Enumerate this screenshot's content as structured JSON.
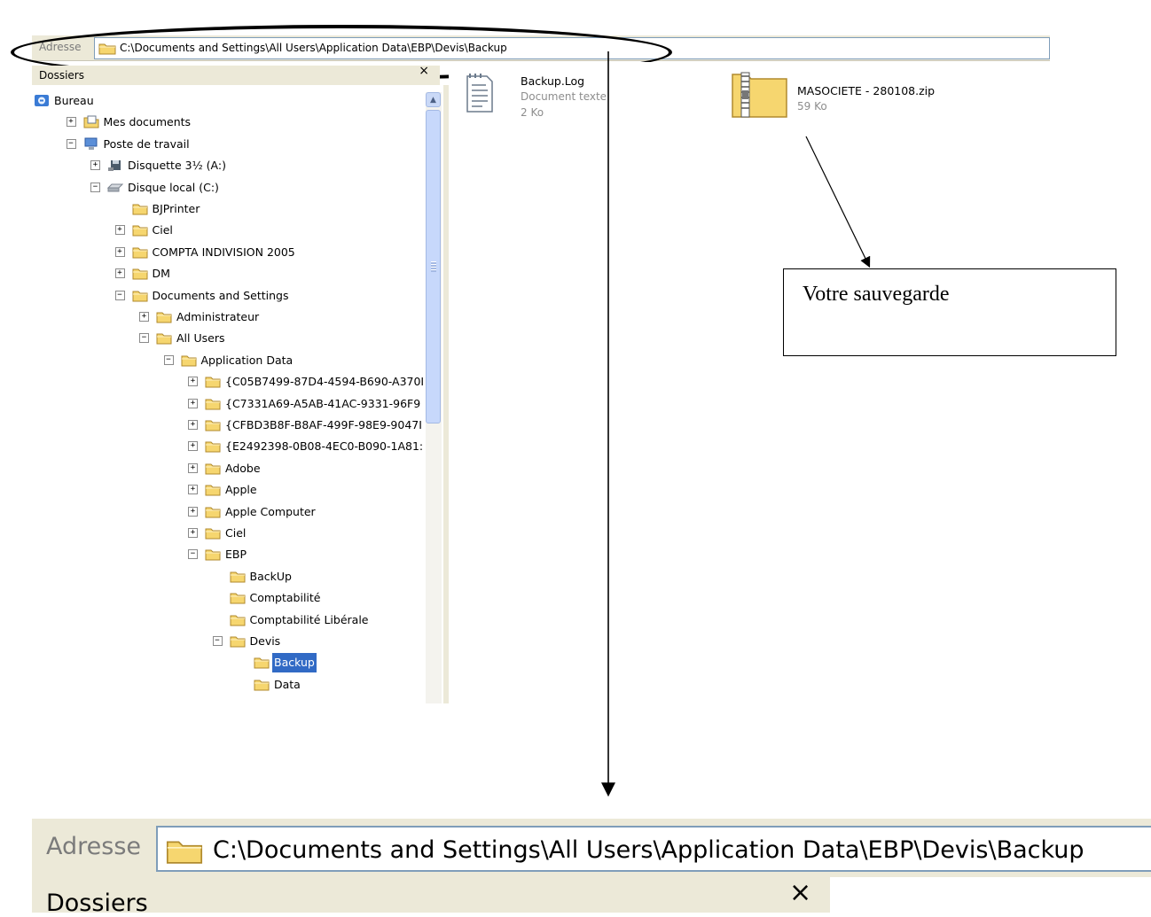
{
  "address_bar": {
    "label": "Adresse",
    "path": "C:\\Documents and Settings\\All Users\\Application Data\\EBP\\Devis\\Backup"
  },
  "folders_panel": {
    "title": "Dossiers",
    "close": "×",
    "tree": [
      {
        "label": "Bureau",
        "icon": "desktop-icon"
      },
      {
        "label": "Mes documents",
        "icon": "documents-icon",
        "expander": "+"
      },
      {
        "label": "Poste de travail",
        "icon": "computer-icon",
        "expander": "−"
      },
      {
        "label": "Disquette 3½ (A:)",
        "icon": "floppy-icon",
        "expander": "+"
      },
      {
        "label": "Disque local (C:)",
        "icon": "drive-icon",
        "expander": "−"
      },
      {
        "label": "BJPrinter",
        "icon": "folder-icon"
      },
      {
        "label": "Ciel",
        "icon": "folder-icon",
        "expander": "+"
      },
      {
        "label": "COMPTA INDIVISION 2005",
        "icon": "folder-icon",
        "expander": "+"
      },
      {
        "label": "DM",
        "icon": "folder-icon",
        "expander": "+"
      },
      {
        "label": "Documents and Settings",
        "icon": "folder-icon",
        "expander": "−"
      },
      {
        "label": "Administrateur",
        "icon": "folder-icon",
        "expander": "+"
      },
      {
        "label": "All Users",
        "icon": "folder-icon",
        "expander": "−"
      },
      {
        "label": "Application Data",
        "icon": "folder-icon",
        "expander": "−"
      },
      {
        "label": "{C05B7499-87D4-4594-B690-A370I",
        "icon": "folder-icon",
        "expander": "+"
      },
      {
        "label": "{C7331A69-A5AB-41AC-9331-96F9",
        "icon": "folder-icon",
        "expander": "+"
      },
      {
        "label": "{CFBD3B8F-B8AF-499F-98E9-9047I",
        "icon": "folder-icon",
        "expander": "+"
      },
      {
        "label": "{E2492398-0B08-4EC0-B090-1A81:",
        "icon": "folder-icon",
        "expander": "+"
      },
      {
        "label": "Adobe",
        "icon": "folder-icon",
        "expander": "+"
      },
      {
        "label": "Apple",
        "icon": "folder-icon",
        "expander": "+"
      },
      {
        "label": "Apple Computer",
        "icon": "folder-icon",
        "expander": "+"
      },
      {
        "label": "Ciel",
        "icon": "folder-icon",
        "expander": "+"
      },
      {
        "label": "EBP",
        "icon": "folder-icon",
        "expander": "−"
      },
      {
        "label": "BackUp",
        "icon": "folder-icon"
      },
      {
        "label": "Comptabilité",
        "icon": "folder-icon"
      },
      {
        "label": "Comptabilité Libérale",
        "icon": "folder-icon"
      },
      {
        "label": "Devis",
        "icon": "folder-icon",
        "expander": "−"
      },
      {
        "label": "Backup",
        "icon": "folder-icon",
        "selected": true
      },
      {
        "label": "Data",
        "icon": "folder-icon"
      }
    ]
  },
  "files": [
    {
      "name": "Backup.Log",
      "type": "Document texte",
      "size": "2 Ko",
      "icon": "text-document-icon"
    },
    {
      "name": "MASOCIETE - 280108.zip",
      "size": "59 Ko",
      "icon": "zip-folder-icon"
    }
  ],
  "annotation": {
    "callout_text": "Votre sauvegarde"
  },
  "zoomed_address_bar": {
    "label": "Adresse",
    "path": "C:\\Documents and Settings\\All Users\\Application Data\\EBP\\Devis\\Backup",
    "folders_title": "Dossiers",
    "close": "×"
  },
  "colors": {
    "selection": "#316ac5",
    "chrome": "#ece9d8",
    "folder_yellow": "#f6d66f"
  }
}
